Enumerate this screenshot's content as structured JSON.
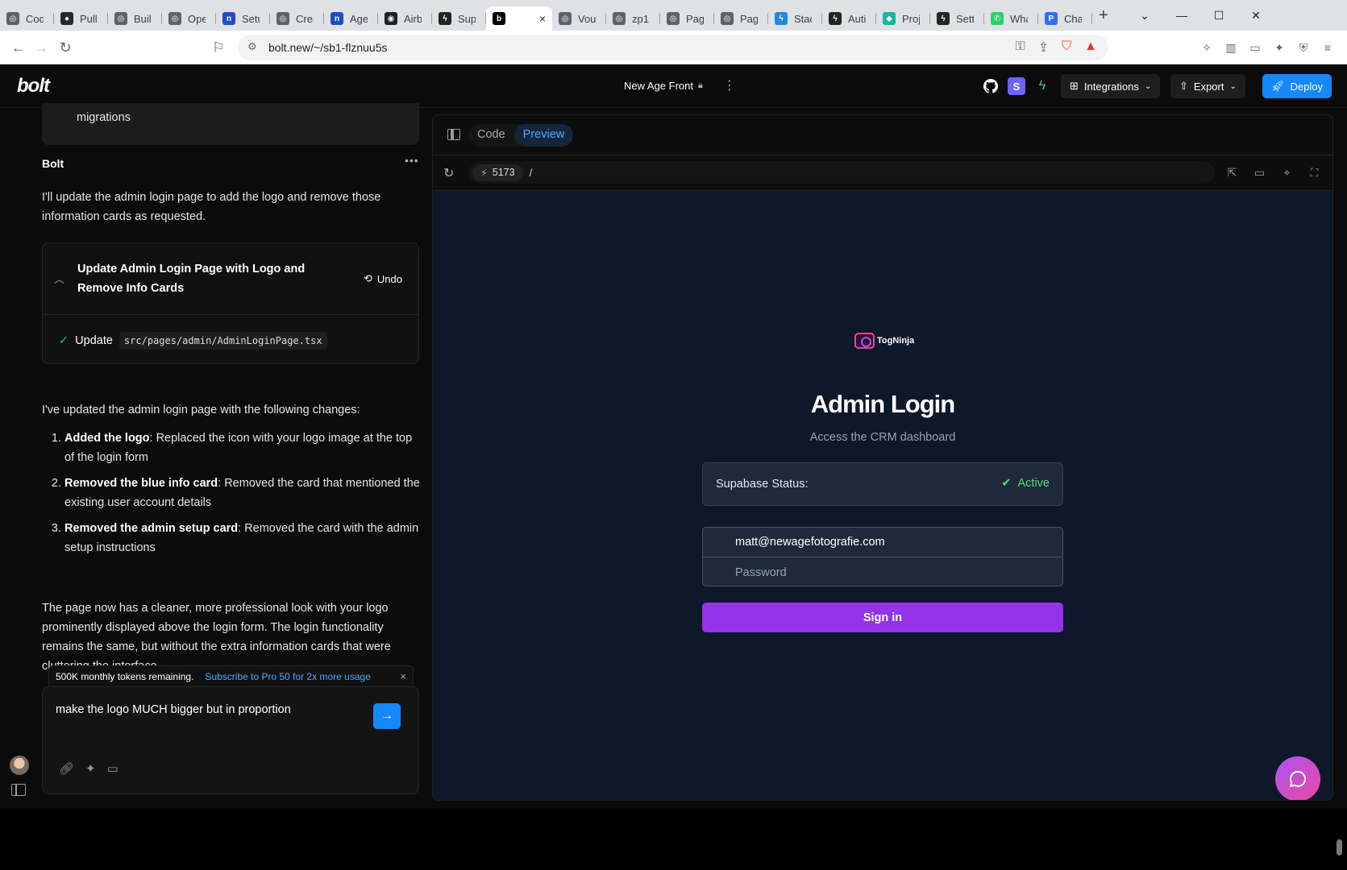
{
  "browser": {
    "tabs": [
      {
        "label": "Cod",
        "fav_color": "#5f6368",
        "fav_glyph": "◎"
      },
      {
        "label": "Pull",
        "fav_color": "#24292f",
        "fav_glyph": "●"
      },
      {
        "label": "Buil",
        "fav_color": "#5f6368",
        "fav_glyph": "◎"
      },
      {
        "label": "Ope",
        "fav_color": "#5f6368",
        "fav_glyph": "◎"
      },
      {
        "label": "Setu",
        "fav_color": "#1f4fbf",
        "fav_glyph": "n"
      },
      {
        "label": "Crea",
        "fav_color": "#5f6368",
        "fav_glyph": "◎"
      },
      {
        "label": "Age",
        "fav_color": "#1f4fbf",
        "fav_glyph": "n"
      },
      {
        "label": "Airb",
        "fav_color": "#202124",
        "fav_glyph": "◉"
      },
      {
        "label": "Sup",
        "fav_color": "#1a2b1f",
        "fav_glyph": "ϟ"
      },
      {
        "label": "Vou",
        "fav_color": "#5f6368",
        "fav_glyph": "◎"
      },
      {
        "label": "zp1",
        "fav_color": "#5f6368",
        "fav_glyph": "◎"
      },
      {
        "label": "Pag",
        "fav_color": "#5f6368",
        "fav_glyph": "◎"
      },
      {
        "label": "Pag",
        "fav_color": "#5f6368",
        "fav_glyph": "◎"
      },
      {
        "label": "Stac",
        "fav_color": "#1e88e5",
        "fav_glyph": "ϟ"
      },
      {
        "label": "Auti",
        "fav_color": "#1a2b1f",
        "fav_glyph": "ϟ"
      },
      {
        "label": "Proj",
        "fav_color": "#14b8a6",
        "fav_glyph": "◆"
      },
      {
        "label": "Setti",
        "fav_color": "#1a2b1f",
        "fav_glyph": "ϟ"
      },
      {
        "label": "Wha",
        "fav_color": "#25d366",
        "fav_glyph": "✆"
      },
      {
        "label": "Cha",
        "fav_color": "#2f6fed",
        "fav_glyph": "P"
      }
    ],
    "active_tab_glyph": "b",
    "active_tab_close": "×",
    "new_tab": "+",
    "url": "bolt.new/~/sb1-flznuu5s"
  },
  "app": {
    "logo": "bolt",
    "project_title": "New Age Front",
    "buttons": {
      "integrations": "Integrations",
      "export": "Export",
      "deploy": "Deploy"
    }
  },
  "chat": {
    "previous_card_text": "migrations",
    "author": "Bolt",
    "intro": "I'll update the admin login page to add the logo and remove those information cards as requested.",
    "artifact": {
      "title": "Update Admin Login Page with Logo and Remove Info Cards",
      "undo": "Undo",
      "action_label": "Update",
      "file": "src/pages/admin/AdminLoginPage.tsx"
    },
    "changes_intro": "I've updated the admin login page with the following changes:",
    "changes": [
      {
        "bold": "Added the logo",
        "text": ": Replaced the icon with your logo image at the top of the login form"
      },
      {
        "bold": "Removed the blue info card",
        "text": ": Removed the card that mentioned the existing user account details"
      },
      {
        "bold": "Removed the admin setup card",
        "text": ": Removed the card with the admin setup instructions"
      }
    ],
    "summary": "The page now has a cleaner, more professional look with your logo prominently displayed above the login form. The login functionality remains the same, but without the extra information cards that were cluttering the interface.",
    "tokens_notice": "500K monthly tokens remaining.",
    "subscribe_link": "Subscribe to Pro 50 for 2x more usage",
    "input_value": "make the logo MUCH bigger but in proportion"
  },
  "workbench": {
    "tabs": [
      "Code",
      "Preview"
    ],
    "active_tab": "Preview",
    "port": "5173",
    "path": "/"
  },
  "preview": {
    "logo_text": "TogNinja",
    "title": "Admin Login",
    "subtitle": "Access the CRM dashboard",
    "status_label": "Supabase Status:",
    "status_value": "Active",
    "status_color": "#4ade80",
    "email_value": "matt@newagefotografie.com",
    "password_placeholder": "Password",
    "signin_label": "Sign in",
    "accent_color": "#9333ea"
  }
}
